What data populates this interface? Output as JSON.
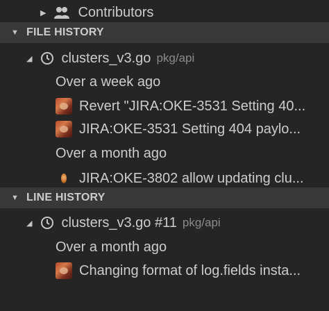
{
  "contributors": {
    "label": "Contributors"
  },
  "file_history": {
    "header": "FILE HISTORY",
    "file": {
      "name": "clusters_v3.go",
      "path": "pkg/api"
    },
    "groups": [
      {
        "label": "Over a week ago",
        "commits": [
          "Revert \"JIRA:OKE-3531 Setting 40...",
          "JIRA:OKE-3531 Setting 404 paylo..."
        ]
      },
      {
        "label": "Over a month ago",
        "commits": [
          "JIRA:OKE-3802 allow updating clu..."
        ]
      }
    ]
  },
  "line_history": {
    "header": "LINE HISTORY",
    "file": {
      "name": "clusters_v3.go #11",
      "path": "pkg/api"
    },
    "groups": [
      {
        "label": "Over a month ago",
        "commits": [
          "Changing format of log.fields insta..."
        ]
      }
    ]
  },
  "icons": {
    "collapsed_twisty": "triangle-right",
    "expanded_twisty": "triangle-down",
    "history": "history-icon",
    "contributors": "people-icon"
  }
}
